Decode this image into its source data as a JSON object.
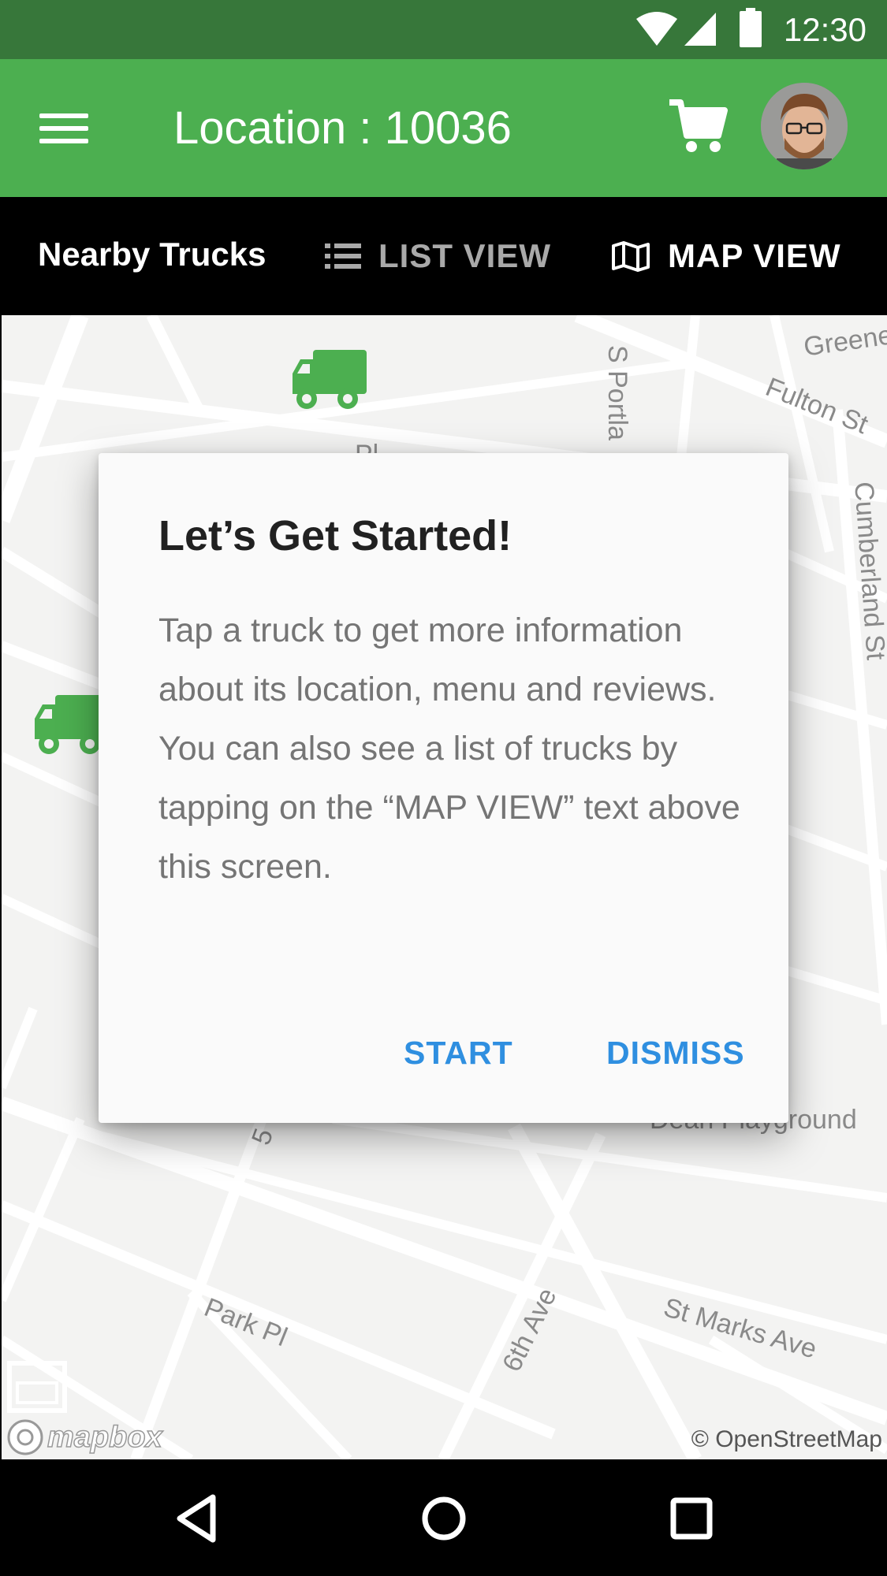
{
  "status_bar": {
    "time": "12:30",
    "icons": [
      "wifi-icon",
      "cell-signal-icon",
      "battery-icon"
    ]
  },
  "app_bar": {
    "title": "Location : 10036",
    "menu_icon": "hamburger-menu-icon",
    "cart_icon": "shopping-cart-icon",
    "avatar": "user-avatar"
  },
  "tabs": {
    "heading": "Nearby Trucks",
    "list_view": {
      "label": "LIST VIEW",
      "icon": "list-icon"
    },
    "map_view": {
      "label": "MAP VIEW",
      "icon": "map-icon",
      "selected": true
    }
  },
  "map": {
    "street_labels": {
      "greene": "Greene",
      "fulton": "Fulton St",
      "portland": "S Portla",
      "cumberland": "Cumberland St",
      "pl": "Pl",
      "five": "5",
      "dean": "Dean Playground",
      "sixth": "6th Ave",
      "st_marks": "St Marks Ave",
      "park_pl": "Park Pl"
    },
    "attribution": {
      "mapbox": "mapbox",
      "osm": "© OpenStreetMap"
    },
    "truck_icon": "food-truck-icon"
  },
  "dialog": {
    "title": "Let’s Get Started!",
    "body": "Tap a truck to get more information about its location, menu and reviews. You can also see a list of trucks by tapping on the “MAP VIEW” text above this screen.",
    "start_label": "START",
    "dismiss_label": "DISMISS"
  },
  "nav_bar": {
    "icons": [
      "back-icon",
      "home-icon",
      "recents-icon"
    ]
  },
  "colors": {
    "status_bar": "#37773a",
    "app_bar": "#4caf50",
    "tab_indicator": "#d9541e",
    "truck": "#4caf50",
    "dialog_button": "#2f8fe0"
  }
}
